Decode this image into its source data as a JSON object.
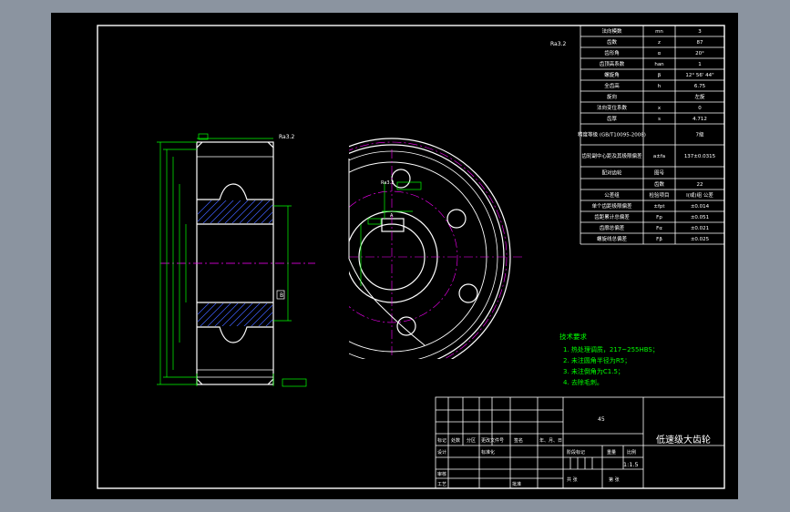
{
  "colors": {
    "background": "#8b94a0",
    "canvas": "#000000",
    "border": "#ffffff",
    "outline": "#ffffff",
    "dimension": "#00ff00",
    "centerline": "#ff00ff",
    "hatch": "#4060ff",
    "notes": "#00ff00"
  },
  "drawing": {
    "roughness_symbol": "Ra3.2",
    "datum_a_label": "A",
    "datum_b_label": "B",
    "section_a_label": "A"
  },
  "param_table": {
    "rows": [
      {
        "name": "法向模数",
        "sym": "mn",
        "val": "3"
      },
      {
        "name": "齿数",
        "sym": "z",
        "val": "87"
      },
      {
        "name": "齿形角",
        "sym": "α",
        "val": "20°"
      },
      {
        "name": "齿顶高系数",
        "sym": "han",
        "val": "1"
      },
      {
        "name": "螺旋角",
        "sym": "β",
        "val": "12° 56' 44\""
      },
      {
        "name": "全齿高",
        "sym": "h",
        "val": "6.75"
      },
      {
        "name": "旋向",
        "sym": "",
        "val": "左旋"
      },
      {
        "name": "法向变位系数",
        "sym": "x",
        "val": "0"
      },
      {
        "name": "齿厚",
        "sym": "s",
        "val": "4.712"
      },
      {
        "name": "精度等级 (GB/T10095-2008)",
        "sym": "",
        "val": "7级"
      },
      {
        "name": "齿轮副中心距及其极限偏差",
        "sym": "a±fa",
        "val": "137±0.0315"
      },
      {
        "name": "配对齿轮",
        "sym": "图号",
        "val": ""
      },
      {
        "name": "",
        "sym": "齿数",
        "val": "22"
      },
      {
        "name": "公差组",
        "sym": "检验项目",
        "val": "I(或)组 公差"
      },
      {
        "name": "单个齿距极限偏差",
        "sym": "±fpt",
        "val": "±0.014"
      },
      {
        "name": "齿距累计总偏差",
        "sym": "Fp",
        "val": "±0.051"
      },
      {
        "name": "齿廓总偏差",
        "sym": "Fα",
        "val": "±0.021"
      },
      {
        "name": "螺旋线总偏差",
        "sym": "Fβ",
        "val": "±0.025"
      }
    ]
  },
  "notes": {
    "title": "技术要求",
    "items": [
      "1. 热处理调质，217~255HBS；",
      "2. 未注圆角半径为R5；",
      "3. 未注倒角为C1.5；",
      "4. 去除毛刺。"
    ]
  },
  "title_block": {
    "part_name": "低速级大齿轮",
    "material": "45",
    "scale": "1:1.5",
    "row_labels": [
      "标记",
      "处数",
      "分区",
      "更改文件号",
      "签名",
      "年、月、日"
    ],
    "design_label": "设计",
    "standardize_label": "标准化",
    "stage_label": "阶段标记",
    "weight_label": "重量",
    "scale_label": "比例",
    "review_label": "审核",
    "process_label": "工艺",
    "approve_label": "批准",
    "sheet_total": "共 张",
    "sheet_no": "第 张"
  }
}
